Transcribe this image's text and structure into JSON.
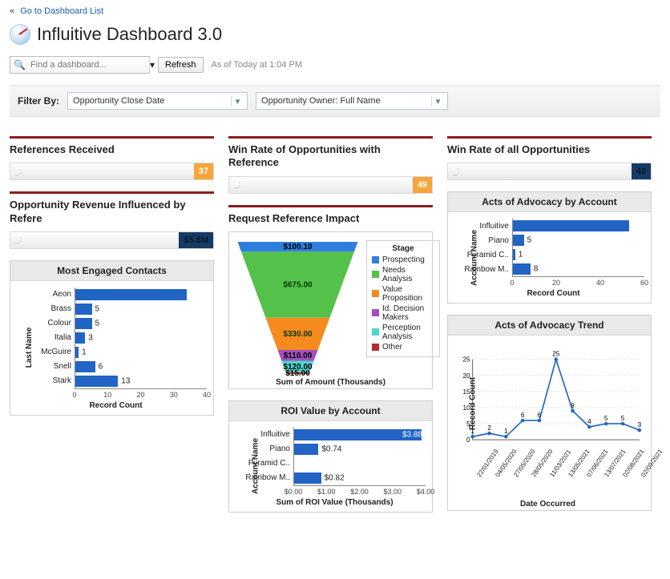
{
  "nav": {
    "back_link": "Go to Dashboard List"
  },
  "header": {
    "title": "Influitive Dashboard 3.0"
  },
  "toolbar": {
    "find_placeholder": "Find a dashboard...",
    "refresh_label": "Refresh",
    "timestamp": "As of Today at 1:04 PM"
  },
  "filter": {
    "label": "Filter By:",
    "dropdown1": "Opportunity Close Date",
    "dropdown2": "Opportunity Owner: Full Name"
  },
  "metrics": {
    "references_received": {
      "title": "References Received",
      "value": "37"
    },
    "revenue_influenced": {
      "title": "Opportunity Revenue Influenced by Refere",
      "value": "$5.8M"
    },
    "win_rate_ref": {
      "title": "Win Rate of Opportunities with Reference",
      "value": "49"
    },
    "win_rate_all": {
      "title": "Win Rate of all Opportunities",
      "value": "49"
    }
  },
  "charts": {
    "engaged_contacts": {
      "title": "Most Engaged Contacts",
      "ylabel": "Last Name",
      "xlabel": "Record Count"
    },
    "request_reference": {
      "title": "Request Reference Impact",
      "xlabel": "Sum of Amount (Thousands)",
      "legend_title": "Stage"
    },
    "roi_by_account": {
      "title": "ROI Value by Account",
      "ylabel": "Account Name",
      "xlabel": "Sum of ROI Value (Thousands)"
    },
    "acts_by_account": {
      "title": "Acts of Advocacy by Account",
      "ylabel": "Account Name",
      "xlabel": "Record Count"
    },
    "acts_trend": {
      "title": "Acts of Advocacy Trend",
      "ylabel": "Record Count",
      "xlabel": "Date Occurred"
    }
  },
  "chart_data": [
    {
      "id": "engaged_contacts",
      "type": "bar",
      "orientation": "horizontal",
      "categories": [
        "Aeon",
        "Brass",
        "Colour",
        "Italia",
        "McGuire",
        "Snell",
        "Stark"
      ],
      "values": [
        34,
        5,
        5,
        3,
        1,
        6,
        13
      ],
      "xlim": [
        0,
        40
      ],
      "xticks": [
        0,
        10,
        20,
        30,
        40
      ],
      "ylabel": "Last Name",
      "xlabel": "Record Count",
      "title": "Most Engaged Contacts"
    },
    {
      "id": "request_reference_impact",
      "type": "funnel",
      "title": "Request Reference Impact",
      "xlabel": "Sum of Amount (Thousands)",
      "series": [
        {
          "name": "Prospecting",
          "value": 100.1,
          "label": "$100.10",
          "color": "#2f7edb"
        },
        {
          "name": "Needs Analysis",
          "value": 675.0,
          "label": "$675.00",
          "color": "#54c14a"
        },
        {
          "name": "Value Proposition",
          "value": 330.0,
          "label": "$330.00",
          "color": "#f58a1f"
        },
        {
          "name": "Id. Decision Makers",
          "value": 110.0,
          "label": "$110.00",
          "color": "#a24fbf"
        },
        {
          "name": "Perception Analysis",
          "value": 120.0,
          "label": "$120.00",
          "color": "#4fd6c9"
        },
        {
          "name": "Other",
          "value": 15.0,
          "label": "$15.00",
          "color": "#b92b2b"
        }
      ]
    },
    {
      "id": "roi_by_account",
      "type": "bar",
      "orientation": "horizontal",
      "categories": [
        "Influitive",
        "Piano",
        "Pyramid C..",
        "Rainbow M.."
      ],
      "values": [
        3.88,
        0.74,
        0,
        0.82
      ],
      "value_labels": [
        "$3.88",
        "$0.74",
        "",
        "$0.82"
      ],
      "xlim": [
        0,
        4
      ],
      "xticks_labels": [
        "$0.00",
        "$1.00",
        "$2.00",
        "$3.00",
        "$4.00"
      ],
      "ylabel": "Account Name",
      "xlabel": "Sum of ROI Value (Thousands)",
      "title": "ROI Value by Account"
    },
    {
      "id": "acts_by_account",
      "type": "bar",
      "orientation": "horizontal",
      "categories": [
        "Influitive",
        "Piano",
        "Pyramid C..",
        "Rainbow M.."
      ],
      "values": [
        53,
        5,
        1,
        8
      ],
      "xlim": [
        0,
        60
      ],
      "xticks": [
        0,
        20,
        40,
        60
      ],
      "ylabel": "Account Name",
      "xlabel": "Record Count",
      "title": "Acts of Advocacy by Account"
    },
    {
      "id": "acts_trend",
      "type": "line",
      "x": [
        "22/01/2019",
        "04/05/2020",
        "27/05/2020",
        "28/05/2020",
        "11/03/2021",
        "13/05/2021",
        "07/06/2021",
        "13/07/2021",
        "02/08/2021",
        "02/09/2021"
      ],
      "y": [
        1,
        2,
        1,
        6,
        6,
        25,
        9,
        4,
        5,
        5,
        3
      ],
      "point_labels": [
        "1",
        "2",
        "1",
        "6",
        "6",
        "25",
        "9",
        "4",
        "5",
        "5",
        "3"
      ],
      "ylim": [
        0,
        25
      ],
      "yticks": [
        0,
        5,
        10,
        15,
        20,
        25
      ],
      "ylabel": "Record Count",
      "xlabel": "Date Occurred",
      "title": "Acts of Advocacy Trend"
    }
  ]
}
